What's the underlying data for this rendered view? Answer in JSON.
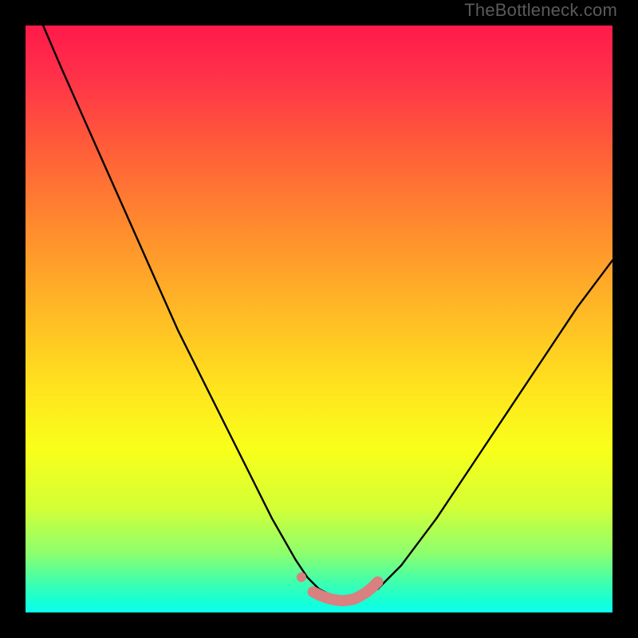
{
  "watermark": "TheBottleneck.com",
  "gradient_colors": {
    "top": "#ff1a4a",
    "mid1": "#ff8a2e",
    "mid2": "#ffe41e",
    "bottom": "#0affee"
  },
  "chart_data": {
    "type": "line",
    "title": "",
    "xlabel": "",
    "ylabel": "",
    "xlim": [
      0,
      100
    ],
    "ylim": [
      0,
      100
    ],
    "series": [
      {
        "name": "bottleneck-curve",
        "x": [
          3,
          6,
          10,
          14,
          18,
          22,
          26,
          30,
          34,
          38,
          42,
          46,
          48,
          50,
          52,
          54,
          56,
          58,
          60,
          64,
          70,
          76,
          82,
          88,
          94,
          100
        ],
        "y": [
          100,
          93,
          84,
          75,
          66,
          57,
          48,
          40,
          32,
          24,
          16,
          9,
          6,
          4,
          3,
          2,
          2,
          3,
          4,
          8,
          16,
          25,
          34,
          43,
          52,
          60
        ]
      }
    ],
    "markers": {
      "name": "valley-markers",
      "color": "#d98080",
      "points": [
        {
          "x": 47,
          "y": 6
        },
        {
          "x": 49,
          "y": 3.5
        },
        {
          "x": 50,
          "y": 3
        },
        {
          "x": 51,
          "y": 2.6
        },
        {
          "x": 52,
          "y": 2.3
        },
        {
          "x": 53,
          "y": 2.1
        },
        {
          "x": 54,
          "y": 2
        },
        {
          "x": 55,
          "y": 2.1
        },
        {
          "x": 56,
          "y": 2.3
        },
        {
          "x": 57,
          "y": 2.8
        },
        {
          "x": 58,
          "y": 3.4
        },
        {
          "x": 59,
          "y": 4.2
        },
        {
          "x": 60,
          "y": 5.2
        }
      ]
    }
  }
}
